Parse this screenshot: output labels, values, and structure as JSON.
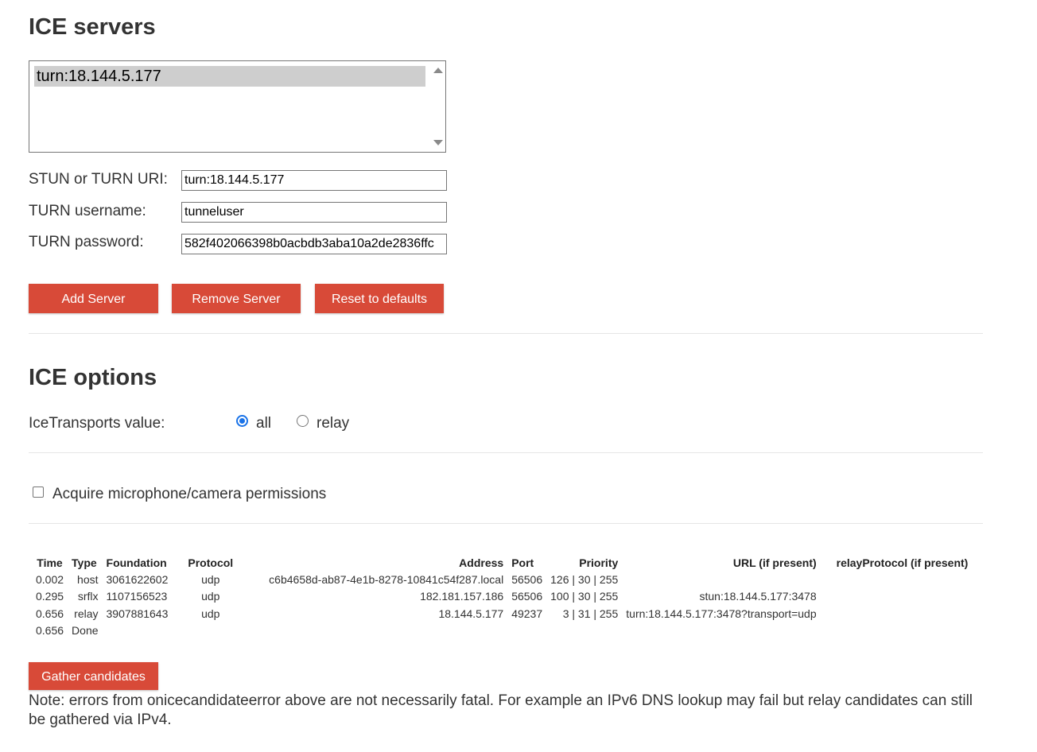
{
  "ice_servers": {
    "title": "ICE servers",
    "list_items": [
      "turn:18.144.5.177"
    ],
    "uri_label": "STUN or TURN URI:",
    "uri_value": "turn:18.144.5.177",
    "username_label": "TURN username:",
    "username_value": "tunneluser",
    "password_label": "TURN password:",
    "password_value": "582f402066398b0acbdb3aba10a2de2836ffc",
    "buttons": {
      "add": "Add Server",
      "remove": "Remove Server",
      "reset": "Reset to defaults"
    }
  },
  "ice_options": {
    "title": "ICE options",
    "transports_label": "IceTransports value:",
    "option_all": "all",
    "option_relay": "relay",
    "selected": "all",
    "accent_color": "#1a73e8"
  },
  "permissions": {
    "label": "Acquire microphone/camera permissions",
    "checked": false
  },
  "candidates": {
    "headers": {
      "time": "Time",
      "type": "Type",
      "foundation": "Foundation",
      "protocol": "Protocol",
      "address": "Address",
      "port": "Port",
      "priority": "Priority",
      "url": "URL (if present)",
      "relay_protocol": "relayProtocol (if present)"
    },
    "rows": [
      {
        "time": "0.002",
        "type": "host",
        "foundation": "3061622602",
        "protocol": "udp",
        "address": "c6b4658d-ab87-4e1b-8278-10841c54f287.local",
        "port": "56506",
        "priority": "126 | 30 | 255",
        "url": "",
        "relay_protocol": ""
      },
      {
        "time": "0.295",
        "type": "srflx",
        "foundation": "1107156523",
        "protocol": "udp",
        "address": "182.181.157.186",
        "port": "56506",
        "priority": "100 | 30 | 255",
        "url": "stun:18.144.5.177:3478",
        "relay_protocol": ""
      },
      {
        "time": "0.656",
        "type": "relay",
        "foundation": "3907881643",
        "protocol": "udp",
        "address": "18.144.5.177",
        "port": "49237",
        "priority": "3 | 31 | 255",
        "url": "turn:18.144.5.177:3478?transport=udp",
        "relay_protocol": ""
      }
    ],
    "done_row": {
      "time": "0.656",
      "status": "Done"
    }
  },
  "gather_button": "Gather candidates",
  "note": "Note: errors from onicecandidateerror above are not necessarily fatal. For example an IPv6 DNS lookup may fail but relay candidates can still be gathered via IPv4.",
  "colors": {
    "button_bg": "#d84a38",
    "text": "#333333",
    "selection_bg": "#cecece"
  }
}
